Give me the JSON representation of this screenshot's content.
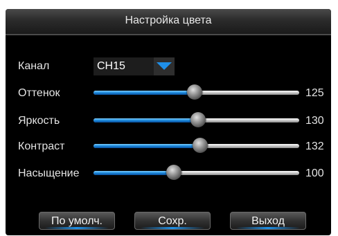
{
  "dialog": {
    "title": "Настройка цвета"
  },
  "channel": {
    "label": "Канал",
    "value": "CH15",
    "arrow_icon": "dropdown-arrow-icon",
    "arrow_color": "#1f8fe8"
  },
  "sliders": [
    {
      "label": "Оттенок",
      "value": "125",
      "level": 0.49
    },
    {
      "label": "Яркость",
      "value": "130",
      "level": 0.51
    },
    {
      "label": "Контраст",
      "value": "132",
      "level": 0.52
    },
    {
      "label": "Насыщение",
      "value": "100",
      "level": 0.39
    }
  ],
  "buttons": {
    "default_label": "По умолч.",
    "save_label": "Сохр.",
    "exit_label": "Выход"
  },
  "colors": {
    "accent": "#1a88dc",
    "background": "#000000",
    "text": "#e4e4e4"
  }
}
